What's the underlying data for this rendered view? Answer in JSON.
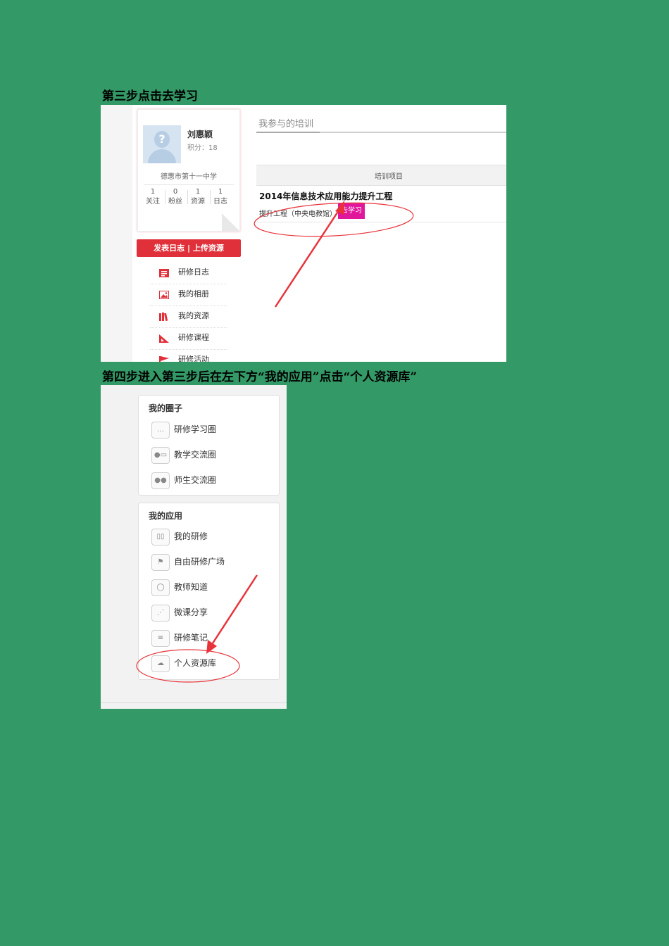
{
  "step3_title": "第三步点击去学习",
  "step4_title": "第四步进入第三步后在左下方“我的应用”点击“个人资源库”",
  "profile": {
    "name": "刘惠颖",
    "score": "积分：18",
    "school": "德惠市第十一中学",
    "stats": [
      {
        "value": "1",
        "label": "关注"
      },
      {
        "value": "0",
        "label": "粉丝"
      },
      {
        "value": "1",
        "label": "资源"
      },
      {
        "value": "1",
        "label": "日志"
      }
    ]
  },
  "action_button": "发表日志 | 上传资源",
  "left_menu": [
    "研修日志",
    "我的相册",
    "我的资源",
    "研修课程",
    "研修活动"
  ],
  "training": {
    "tab": "我参与的培训",
    "column_header": "培训项目",
    "project_title": "2014年信息技术应用能力提升工程",
    "project_sub": "提升工程（中央电教馆）",
    "go_button": "去学习"
  },
  "circles": {
    "title": "我的圈子",
    "items": [
      "研修学习圈",
      "教学交流圈",
      "师生交流圈"
    ]
  },
  "apps": {
    "title": "我的应用",
    "items": [
      "我的研修",
      "自由研修广场",
      "教师知道",
      "微课分享",
      "研修笔记",
      "个人资源库"
    ]
  },
  "colors": {
    "page_bg": "#339966",
    "accent_red": "#e0313b",
    "go_button": "#e0179b",
    "annotation": "#e8333a"
  }
}
